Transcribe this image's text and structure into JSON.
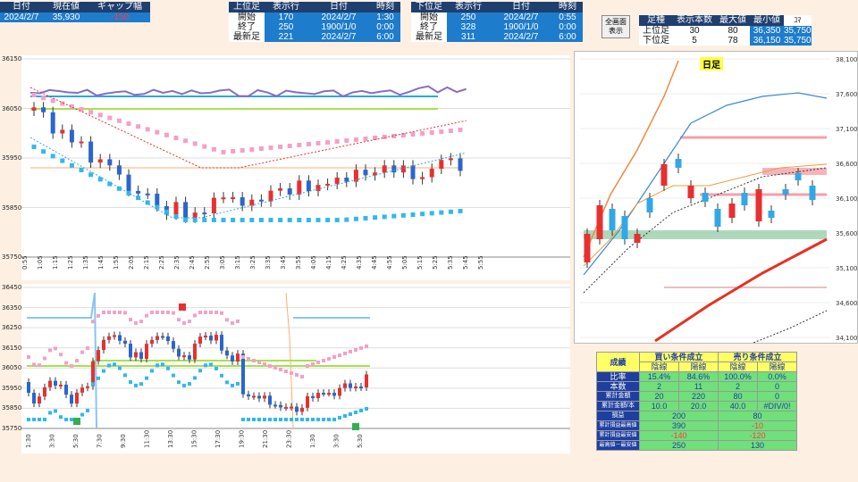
{
  "summary": {
    "headers": [
      "日付",
      "現在値",
      "ギャップ幅"
    ],
    "values": [
      "2024/2/7",
      "35,930",
      "-150"
    ]
  },
  "upper": {
    "headers": [
      "上位足",
      "表示行",
      "日付",
      "時刻"
    ],
    "rows": [
      [
        "開始",
        "170",
        "2024/2/7",
        "1:30"
      ],
      [
        "終了",
        "250",
        "1900/1/0",
        "0:00"
      ],
      [
        "最新足",
        "221",
        "2024/2/7",
        "6:00"
      ]
    ]
  },
  "lower": {
    "headers": [
      "下位足",
      "表示行",
      "日付",
      "時刻"
    ],
    "rows": [
      [
        "開始",
        "250",
        "2024/2/7",
        "0:55"
      ],
      [
        "終了",
        "328",
        "1900/1/0",
        "0:00"
      ],
      [
        "最新足",
        "311",
        "2024/2/7",
        "6:00"
      ]
    ]
  },
  "fullscreen_button": "全画面\n表示",
  "frames": {
    "headers": [
      "足種",
      "表示本数",
      "最大値",
      "最小値",
      "ｺﾏ"
    ],
    "rows": [
      [
        "上位足",
        "30",
        "80",
        "36,350",
        "35,750"
      ],
      [
        "下位足",
        "5",
        "78",
        "36,150",
        "35,750"
      ]
    ]
  },
  "chart1": {
    "y_ticks": [
      "36150",
      "36050",
      "35950",
      "35850",
      "35750"
    ],
    "x_ticks": [
      "0:55",
      "1:05",
      "1:15",
      "1:25",
      "1:35",
      "1:45",
      "1:55",
      "2:05",
      "2:15",
      "2:25",
      "2:35",
      "2:45",
      "2:55",
      "3:05",
      "3:15",
      "3:25",
      "3:35",
      "3:45",
      "3:55",
      "4:05",
      "4:15",
      "4:25",
      "4:35",
      "4:45",
      "4:55",
      "5:05",
      "5:15",
      "5:25",
      "5:35",
      "5:45",
      "5:55"
    ]
  },
  "chart2": {
    "y_ticks": [
      "36450",
      "36350",
      "36250",
      "36150",
      "36050",
      "35950",
      "35850",
      "35750"
    ],
    "x_ticks": [
      "1:30",
      "3:30",
      "5:30",
      "7:30",
      "9:30",
      "11:30",
      "13:30",
      "15:30",
      "17:30",
      "19:30",
      "21:30",
      "23:30",
      "1:30",
      "3:30",
      "5:30"
    ]
  },
  "daily": {
    "title": "日足",
    "y_ticks": [
      "38,100",
      "37,600",
      "37,100",
      "36,600",
      "36,100",
      "35,600",
      "35,100",
      "34,600",
      "34,100"
    ]
  },
  "results": {
    "title": "成績",
    "buy_header": "買い条件成立",
    "sell_header": "売り条件成立",
    "sub_headers": [
      "陰線",
      "陽線",
      "陰線",
      "陽線"
    ],
    "rows": [
      {
        "label": "比率",
        "values": [
          "15.4%",
          "84.6%",
          "100.0%",
          "0.0%"
        ]
      },
      {
        "label": "本数",
        "values": [
          "2",
          "11",
          "2",
          "0"
        ]
      },
      {
        "label": "累計金額",
        "values": [
          "20",
          "220",
          "80",
          "0"
        ]
      },
      {
        "label": "累計金額/本",
        "values": [
          "10.0",
          "20.0",
          "40.0",
          "#DIV/0!"
        ]
      }
    ],
    "merged_rows": [
      {
        "label": "損益",
        "buy": "200",
        "sell": "80"
      },
      {
        "label": "累計損益最高値",
        "buy": "390",
        "sell": "-10"
      },
      {
        "label": "累計損益最安値",
        "buy": "-140",
        "sell": "-120"
      },
      {
        "label": "最高値－最安値",
        "buy": "250",
        "sell": "130"
      }
    ]
  },
  "colors": {
    "header_bg": "#1f3f6f",
    "value_bg": "#1d7ccc",
    "page_bg": "#fdf0e3",
    "negative": "#ff3b3b",
    "results_header": "#ffff66",
    "results_row": "#6fe07a"
  }
}
